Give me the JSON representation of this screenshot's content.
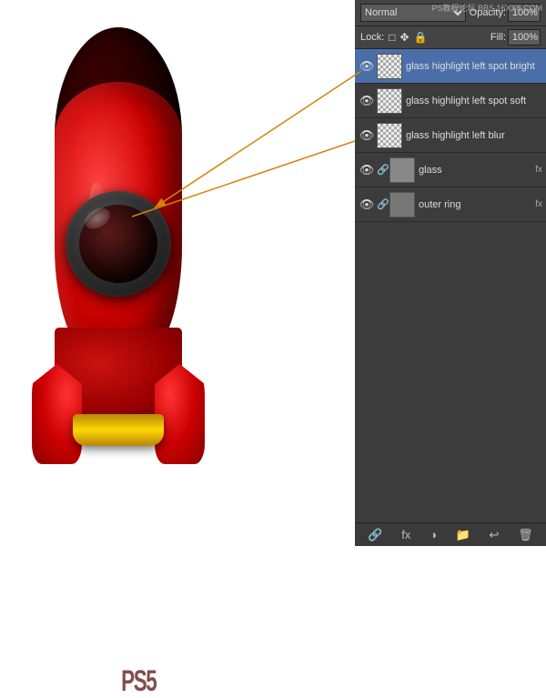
{
  "panel": {
    "watermark": "PS教程论坛\nBBS.16XX8.COM",
    "blend_mode": "Normal",
    "opacity_label": "Opacity:",
    "opacity_value": "100%",
    "lock_label": "Lock:",
    "fill_label": "Fill:",
    "fill_value": "100%",
    "layers": [
      {
        "id": "layer-1",
        "name": "glass highlight left spot bright",
        "visible": true,
        "selected": true,
        "has_fx": false,
        "has_chain": false,
        "thumb_type": "checker"
      },
      {
        "id": "layer-2",
        "name": "glass highlight left spot soft",
        "visible": true,
        "selected": false,
        "has_fx": false,
        "has_chain": false,
        "thumb_type": "checker"
      },
      {
        "id": "layer-3",
        "name": "glass highlight left blur",
        "visible": true,
        "selected": false,
        "has_fx": false,
        "has_chain": false,
        "thumb_type": "checker"
      },
      {
        "id": "layer-4",
        "name": "glass",
        "visible": true,
        "selected": false,
        "has_fx": true,
        "has_chain": true,
        "thumb_type": "solid"
      },
      {
        "id": "layer-5",
        "name": "outer ring",
        "visible": true,
        "selected": false,
        "has_fx": true,
        "has_chain": true,
        "thumb_type": "solid"
      }
    ],
    "bottom_tools": [
      "🔗",
      "fx",
      "◑",
      "📁",
      "↩",
      "🗑"
    ]
  }
}
